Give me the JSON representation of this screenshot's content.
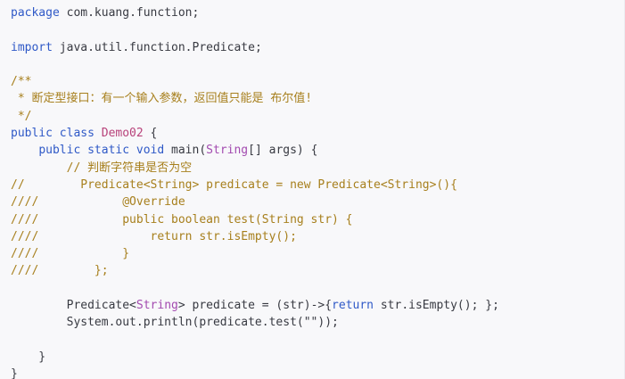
{
  "code_lines": [
    [
      {
        "t": "package",
        "c": "kw"
      },
      {
        "t": " com.kuang.function;",
        "c": ""
      }
    ],
    [],
    [
      {
        "t": "import",
        "c": "kw"
      },
      {
        "t": " java.util.function.Predicate;",
        "c": ""
      }
    ],
    [],
    [
      {
        "t": "/**",
        "c": "cm"
      }
    ],
    [
      {
        "t": " * 断定型接口：有一个输入参数，返回值只能是 布尔值!",
        "c": "cm"
      }
    ],
    [
      {
        "t": " */",
        "c": "cm"
      }
    ],
    [
      {
        "t": "public class",
        "c": "kw"
      },
      {
        "t": " ",
        "c": ""
      },
      {
        "t": "Demo02",
        "c": "cls"
      },
      {
        "t": " {",
        "c": ""
      }
    ],
    [
      {
        "t": "    ",
        "c": ""
      },
      {
        "t": "public static void",
        "c": "kw"
      },
      {
        "t": " main(",
        "c": ""
      },
      {
        "t": "String",
        "c": "ty"
      },
      {
        "t": "[] args) {",
        "c": ""
      }
    ],
    [
      {
        "t": "        // 判断字符串是否为空",
        "c": "cm"
      }
    ],
    [
      {
        "t": "//        Predicate<String> predicate = new Predicate<String>(){",
        "c": "cm"
      }
    ],
    [
      {
        "t": "////            @Override",
        "c": "cm"
      }
    ],
    [
      {
        "t": "////            public boolean test(String str) {",
        "c": "cm"
      }
    ],
    [
      {
        "t": "////                return str.isEmpty();",
        "c": "cm"
      }
    ],
    [
      {
        "t": "////            }",
        "c": "cm"
      }
    ],
    [
      {
        "t": "////        };",
        "c": "cm"
      }
    ],
    [],
    [
      {
        "t": "        Predicate<",
        "c": ""
      },
      {
        "t": "String",
        "c": "ty"
      },
      {
        "t": "> predicate = (str)->{",
        "c": ""
      },
      {
        "t": "return",
        "c": "kw"
      },
      {
        "t": " str.isEmpty(); };",
        "c": ""
      }
    ],
    [
      {
        "t": "        System.out.println(predicate.test(\"\"));",
        "c": ""
      }
    ],
    [],
    [
      {
        "t": "    }",
        "c": ""
      }
    ],
    [
      {
        "t": "}",
        "c": ""
      }
    ]
  ]
}
